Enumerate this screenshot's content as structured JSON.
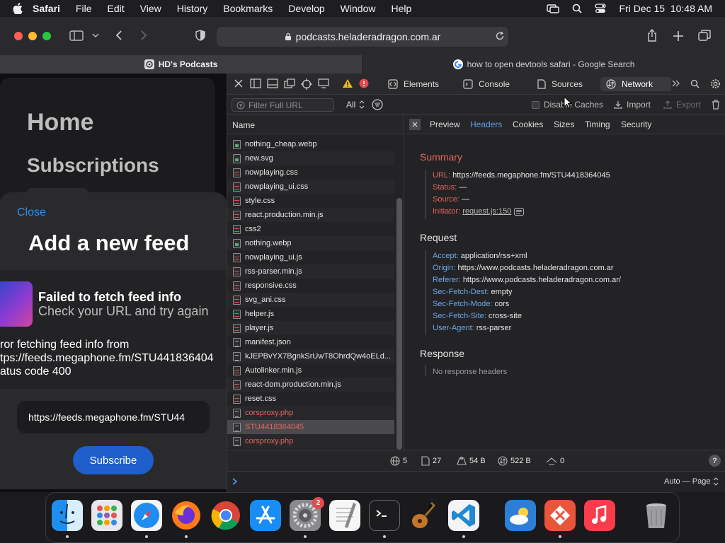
{
  "menubar": {
    "app": "Safari",
    "items": [
      "File",
      "Edit",
      "View",
      "History",
      "Bookmarks",
      "Develop",
      "Window",
      "Help"
    ],
    "datetime": "Fri Dec 15  10:48 AM"
  },
  "toolbar": {
    "url": "podcasts.heladeradragon.com.ar"
  },
  "tabs": [
    {
      "label": "HD's Podcasts"
    },
    {
      "label": "how to open devtools safari - Google Search"
    }
  ],
  "page": {
    "home": "Home",
    "subscriptions": "Subscriptions",
    "close": "Close",
    "heading": "Add a new feed",
    "error_title": "Failed to fetch feed info",
    "error_sub": "Check your URL and try again",
    "error_msg": [
      "ror fetching feed info from",
      "tps://feeds.megaphone.fm/STU441836404",
      "atus code 400"
    ],
    "url_value": "https://feeds.megaphone.fm/STU44",
    "subscribe": "Subscribe"
  },
  "devtools": {
    "tabs": [
      "Elements",
      "Console",
      "Sources",
      "Network"
    ],
    "filter_placeholder": "Filter Full URL",
    "type_filter": "All",
    "disable_caches": "Disable Caches",
    "import": "Import",
    "export": "Export",
    "name_col": "Name",
    "files": [
      {
        "name": "nothing_cheap.webp",
        "type": "img"
      },
      {
        "name": "new.svg",
        "type": "img"
      },
      {
        "name": "nowplaying.css",
        "type": "code"
      },
      {
        "name": "nowplaying_ui.css",
        "type": "code"
      },
      {
        "name": "style.css",
        "type": "code"
      },
      {
        "name": "react.production.min.js",
        "type": "code"
      },
      {
        "name": "css2",
        "type": "code"
      },
      {
        "name": "nothing.webp",
        "type": "img"
      },
      {
        "name": "nowplaying_ui.js",
        "type": "code"
      },
      {
        "name": "rss-parser.min.js",
        "type": "code"
      },
      {
        "name": "responsive.css",
        "type": "code"
      },
      {
        "name": "svg_ani.css",
        "type": "code"
      },
      {
        "name": "helper.js",
        "type": "code"
      },
      {
        "name": "player.js",
        "type": "code"
      },
      {
        "name": "manifest.json",
        "type": "doc"
      },
      {
        "name": "kJEPBvYX7BgnkSrUwT8OhrdQw4oELd...",
        "type": "doc"
      },
      {
        "name": "Autolinker.min.js",
        "type": "code"
      },
      {
        "name": "react-dom.production.min.js",
        "type": "code"
      },
      {
        "name": "reset.css",
        "type": "code"
      },
      {
        "name": "corsproxy.php",
        "type": "doc",
        "error": true
      },
      {
        "name": "STU4418364045",
        "type": "doc",
        "error": true,
        "selected": true
      },
      {
        "name": "corsproxy.php",
        "type": "doc",
        "error": true
      }
    ],
    "detail_tabs": [
      "Preview",
      "Headers",
      "Cookies",
      "Sizes",
      "Timing",
      "Security"
    ],
    "summary": {
      "title": "Summary",
      "rows": [
        {
          "k": "URL:",
          "v": "https://feeds.megaphone.fm/STU4418364045"
        },
        {
          "k": "Status:",
          "v": "—"
        },
        {
          "k": "Source:",
          "v": "—"
        },
        {
          "k": "Initiator:",
          "v": "request.js:150"
        }
      ]
    },
    "request": {
      "title": "Request",
      "rows": [
        {
          "k": "Accept:",
          "v": "application/rss+xml"
        },
        {
          "k": "Origin:",
          "v": "https://www.podcasts.heladeradragon.com.ar"
        },
        {
          "k": "Referer:",
          "v": "https://www.podcasts.heladeradragon.com.ar/"
        },
        {
          "k": "Sec-Fetch-Dest:",
          "v": "empty"
        },
        {
          "k": "Sec-Fetch-Mode:",
          "v": "cors"
        },
        {
          "k": "Sec-Fetch-Site:",
          "v": "cross-site"
        },
        {
          "k": "User-Agent:",
          "v": "rss-parser"
        }
      ]
    },
    "response": {
      "title": "Response",
      "empty": "No response headers"
    },
    "status": {
      "domains": "5",
      "resources": "27",
      "transferred": "54 B",
      "size": "522 B",
      "time": "0"
    },
    "console_mode": "Auto — Page"
  },
  "dock": {
    "badge": "2"
  }
}
